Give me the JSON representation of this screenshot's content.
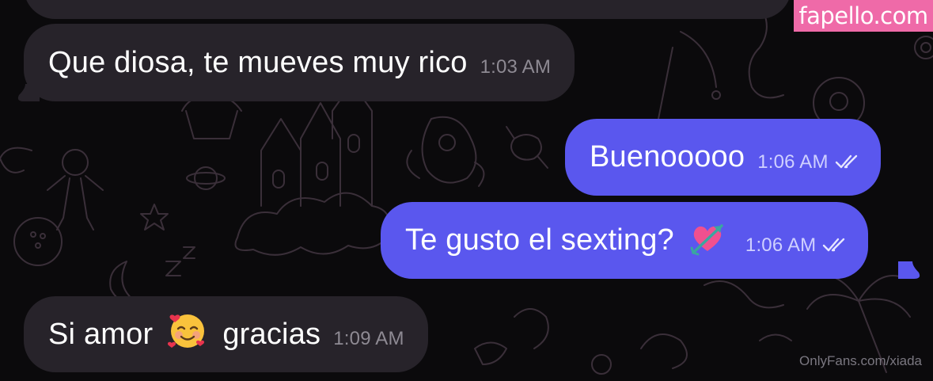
{
  "colors": {
    "background": "#0b0a0c",
    "incoming_bubble": "#27232a",
    "outgoing_bubble": "#5a57ee",
    "watermark_badge": "#ef6aa8"
  },
  "messages": [
    {
      "direction": "incoming",
      "text": "Que diosa, te mueves muy rico",
      "time": "1:03 AM"
    },
    {
      "direction": "outgoing",
      "text": "Buenooooo",
      "time": "1:06 AM",
      "status": "read",
      "status_icon": "double-check-icon"
    },
    {
      "direction": "outgoing",
      "text": "Te gusto el sexting?",
      "emoji": "💘",
      "emoji_icon": "heart-with-arrow-icon",
      "time": "1:06 AM",
      "status": "read",
      "status_icon": "double-check-icon"
    },
    {
      "direction": "incoming",
      "text_before": "Si amor",
      "emoji": "🥰",
      "emoji_icon": "smiling-face-with-hearts-icon",
      "text_after": "gracias",
      "time": "1:09 AM"
    }
  ],
  "watermarks": {
    "badge": "fapello.com",
    "footer": "OnlyFans.com/xiada"
  }
}
